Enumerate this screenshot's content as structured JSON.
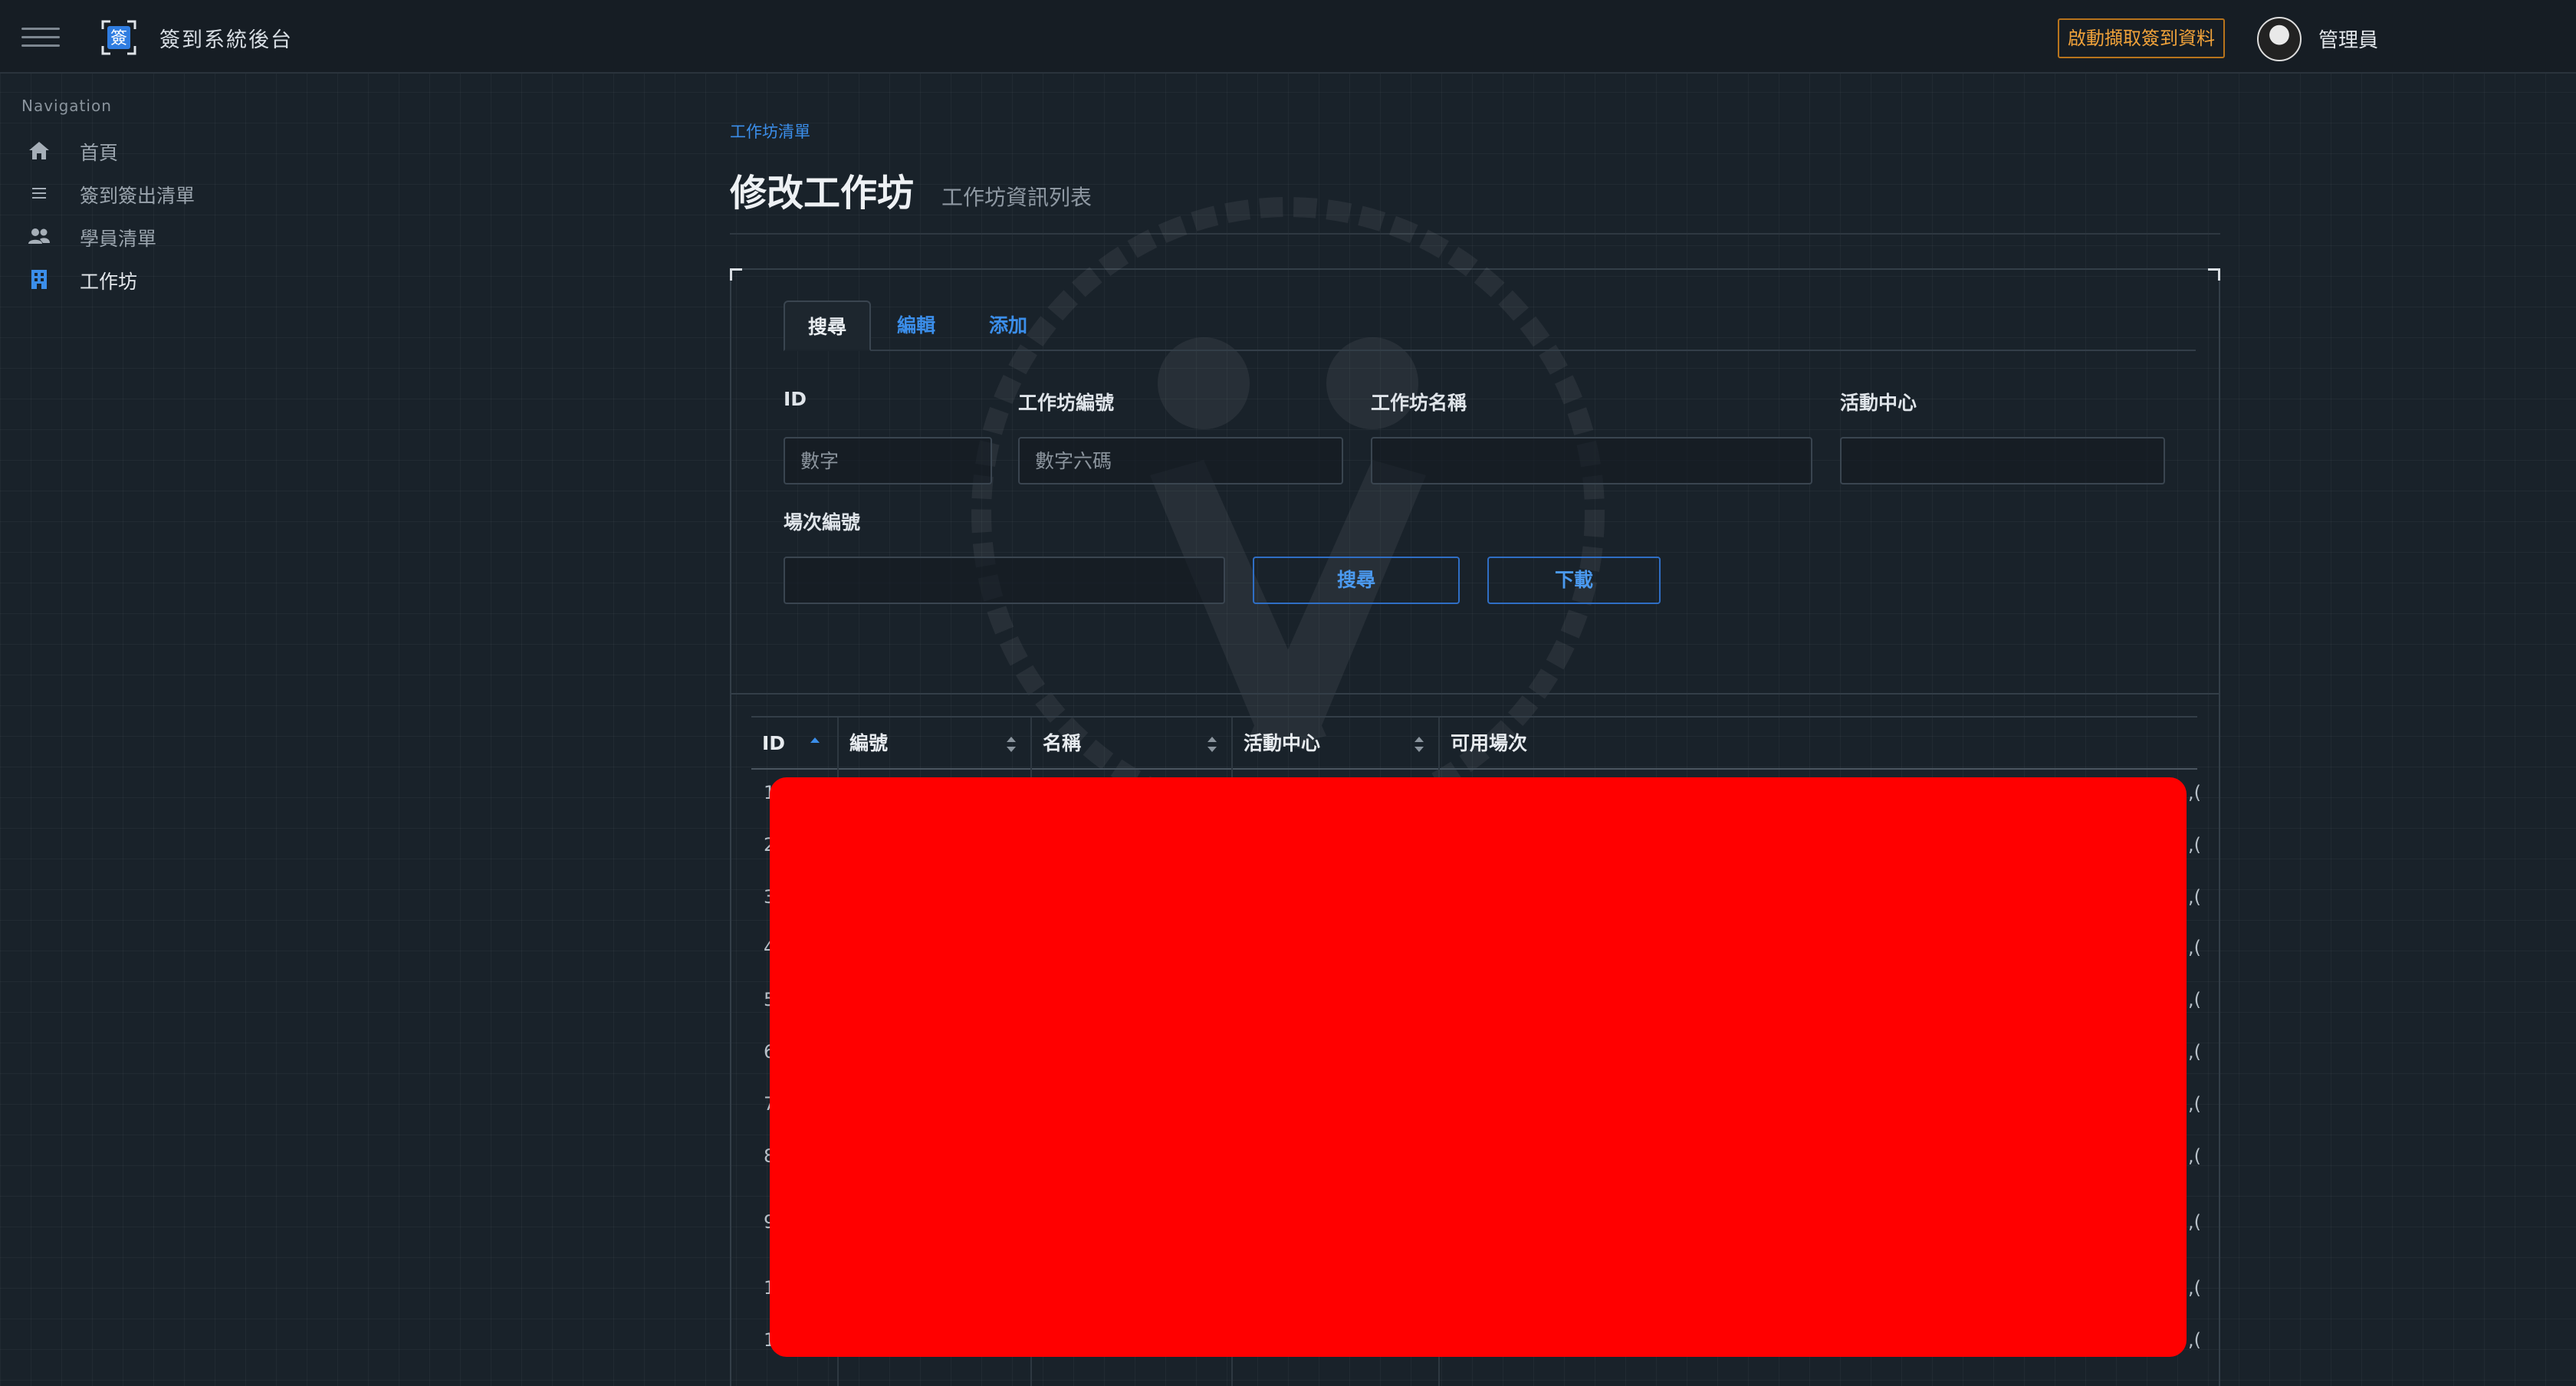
{
  "header": {
    "app_title": "簽到系統後台",
    "logo_char": "簽",
    "fetch_button": "啟動擷取簽到資料",
    "username": "管理員"
  },
  "sidebar": {
    "title": "Navigation",
    "items": [
      {
        "label": "首頁",
        "icon": "home-icon"
      },
      {
        "label": "簽到簽出清單",
        "icon": "list-icon"
      },
      {
        "label": "學員清單",
        "icon": "users-icon"
      },
      {
        "label": "工作坊",
        "icon": "building-icon",
        "active": true
      }
    ]
  },
  "page": {
    "breadcrumb": "工作坊清單",
    "title": "修改工作坊",
    "subtitle": "工作坊資訊列表"
  },
  "tabs": [
    {
      "label": "搜尋",
      "active": true
    },
    {
      "label": "編輯"
    },
    {
      "label": "添加"
    }
  ],
  "form": {
    "id_label": "ID",
    "id_placeholder": "數字",
    "code_label": "工作坊編號",
    "code_placeholder": "數字六碼",
    "name_label": "工作坊名稱",
    "center_label": "活動中心",
    "session_label": "場次編號",
    "search_button": "搜尋",
    "download_button": "下載"
  },
  "table": {
    "columns": [
      "ID",
      "編號",
      "名稱",
      "活動中心",
      "可用場次"
    ],
    "row_ids": [
      "1",
      "2",
      "3",
      "4",
      "5",
      "6",
      "7",
      "8",
      "9",
      "1",
      "1"
    ],
    "row_tail": ",("
  },
  "colors": {
    "accent": "#3b8eea",
    "warning": "#f0a23a",
    "redaction": "#ff0000"
  }
}
